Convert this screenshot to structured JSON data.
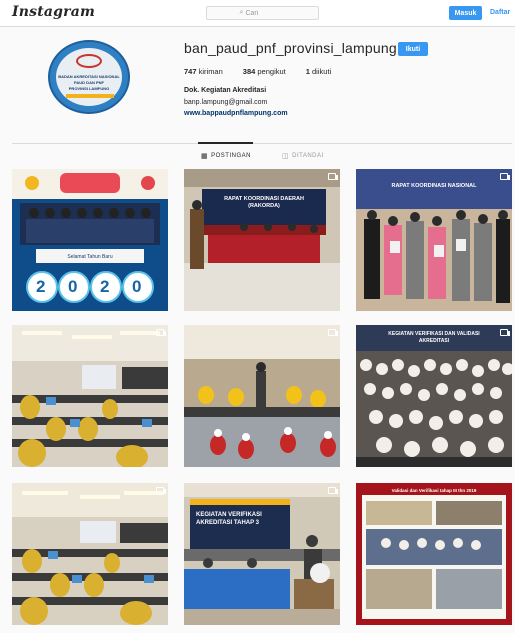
{
  "nav": {
    "logo": "Instagram",
    "search_placeholder": "Cari",
    "login_label": "Masuk",
    "signup_label": "Daftar"
  },
  "profile": {
    "username": "ban_paud_pnf_provinsi_lampung",
    "follow_label": "Ikuti",
    "stats": {
      "posts_count": "747",
      "posts_label": "kiriman",
      "followers_count": "384",
      "followers_label": "pengikut",
      "following_count": "1",
      "following_label": "diikuti"
    },
    "bio_name": "Dok. Kegiatan Akreditasi",
    "email": "banp.lampung@gmail.com",
    "website": "www.bappaudpnflampung.com",
    "avatar_text": {
      "line1": "BADAN AKREDITASI NASIONAL",
      "line2": "PAUD DAN PNF",
      "line3": "PROVINSI LAMPUNG"
    }
  },
  "tabs": {
    "posts": "POSTINGAN",
    "tagged": "DITANDAI"
  },
  "posts": [
    {
      "texts": {
        "year": "2020",
        "greeting": "Selamat Tahun Baru"
      },
      "icon": "none"
    },
    {
      "texts": {
        "banner": "RAPAT KOORDINASI DAERAH (RAKORDA)"
      },
      "icon": "carousel-icon"
    },
    {
      "texts": {
        "banner": "RAPAT KOORDINASI NASIONAL"
      },
      "icon": "carousel-icon"
    },
    {
      "texts": {},
      "icon": "carousel-icon"
    },
    {
      "texts": {},
      "icon": "carousel-icon"
    },
    {
      "texts": {
        "banner": "KEGIATAN VERIFIKASI DAN VALIDASI AKREDITASI"
      },
      "icon": "carousel-icon"
    },
    {
      "texts": {},
      "icon": "carousel-icon"
    },
    {
      "texts": {
        "banner": "KEGIATAN VERIFIKASI AKREDITASI TAHAP 3"
      },
      "icon": "carousel-icon"
    },
    {
      "texts": {
        "header": "Validasi dan Verifikasi tahap III thn 2019"
      },
      "icon": "none"
    }
  ],
  "colors": {
    "accent": "#3897f0",
    "link": "#003569",
    "border": "#dbdbdb",
    "background": "#fafafa"
  }
}
